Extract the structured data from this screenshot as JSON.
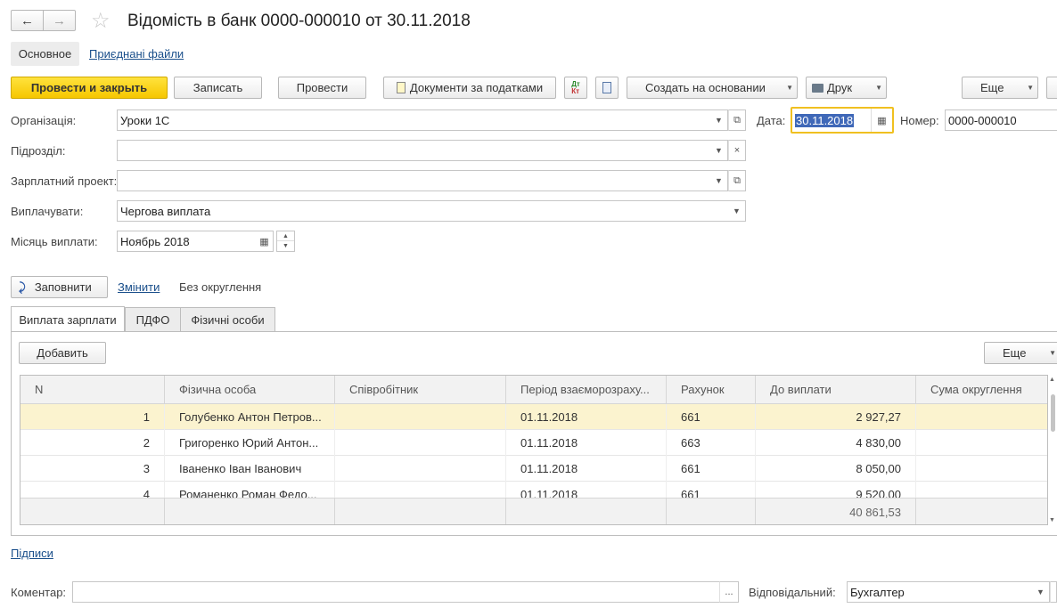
{
  "title": "Відомість в банк 0000-000010 от 30.11.2018",
  "sections": {
    "main": "Основное",
    "files": "Приєднані файли"
  },
  "toolbar": {
    "post_close": "Провести и закрыть",
    "save": "Записать",
    "post": "Провести",
    "tax_docs": "Документи за податками",
    "create_based": "Создать на основании",
    "print": "Друк",
    "more": "Еще"
  },
  "form": {
    "org_label": "Організація:",
    "org_value": "Уроки 1С",
    "date_label": "Дата:",
    "date_value": "30.11.2018",
    "number_label": "Номер:",
    "number_value": "0000-000010",
    "dept_label": "Підрозділ:",
    "dept_value": "",
    "project_label": "Зарплатний проект:",
    "project_value": "",
    "pay_label": "Виплачувати:",
    "pay_value": "Чергова виплата",
    "month_label": "Місяць виплати:",
    "month_value": "Ноябрь 2018"
  },
  "fill": {
    "fill_button": "Заповнити",
    "change_link": "Змінити",
    "rounding": "Без округлення"
  },
  "tabs": [
    "Виплата зарплати",
    "ПДФО",
    "Фізичні особи"
  ],
  "table_toolbar": {
    "add": "Добавить",
    "more": "Еще"
  },
  "table": {
    "columns": [
      "N",
      "Фізична особа",
      "Співробітник",
      "Період взаєморозраху...",
      "Рахунок",
      "До виплати",
      "Сума округлення"
    ],
    "rows": [
      {
        "n": "1",
        "person": "Голубенко Антон Петров...",
        "employee": "",
        "period": "01.11.2018",
        "account": "661",
        "amount": "2 927,27",
        "rounding": ""
      },
      {
        "n": "2",
        "person": "Григоренко Юрий Антон...",
        "employee": "",
        "period": "01.11.2018",
        "account": "663",
        "amount": "4 830,00",
        "rounding": ""
      },
      {
        "n": "3",
        "person": "Іваненко Іван Іванович",
        "employee": "",
        "period": "01.11.2018",
        "account": "661",
        "amount": "8 050,00",
        "rounding": ""
      },
      {
        "n": "4",
        "person": "Романенко Роман Федо...",
        "employee": "",
        "period": "01.11.2018",
        "account": "661",
        "amount": "9 520,00",
        "rounding": ""
      }
    ],
    "total": "40 861,53"
  },
  "signatures_link": "Підписи",
  "footer": {
    "comment_label": "Коментар:",
    "comment_value": "",
    "responsible_label": "Відповідальний:",
    "responsible_value": "Бухгалтер"
  },
  "colors": {
    "primary": "#f6c600",
    "selected_row": "#fbf3cf",
    "link": "#1a4f8b",
    "date_focus": "#f0c020"
  }
}
